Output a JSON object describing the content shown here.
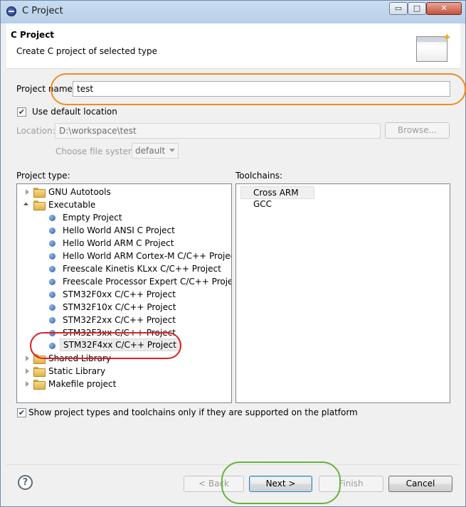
{
  "window": {
    "title": "C Project",
    "min_label": "▭",
    "max_label": "□",
    "close_label": "✕"
  },
  "header": {
    "title": "C Project",
    "description": "Create C project of selected type",
    "banner_icon": "wizard-banner-icon"
  },
  "form": {
    "project_name_label": "Project name:",
    "project_name_value": "test",
    "use_default_location_label": "Use default location",
    "use_default_location_checked": true,
    "location_label": "Location:",
    "location_value": "D:\\workspace\\test",
    "browse_label": "Browse...",
    "choose_fs_label": "Choose file system:",
    "file_system_value": "default"
  },
  "project_type": {
    "label": "Project type:",
    "items": [
      {
        "label": "GNU Autotools"
      },
      {
        "label": "Executable"
      },
      {
        "label": "Empty Project"
      },
      {
        "label": "Hello World ANSI C Project"
      },
      {
        "label": "Hello World ARM C Project"
      },
      {
        "label": "Hello World ARM Cortex-M C/C++ Project"
      },
      {
        "label": "Freescale Kinetis KLxx C/C++ Project"
      },
      {
        "label": "Freescale Processor Expert C/C++ Project"
      },
      {
        "label": "STM32F0xx C/C++ Project"
      },
      {
        "label": "STM32F10x C/C++ Project"
      },
      {
        "label": "STM32F2xx C/C++ Project"
      },
      {
        "label": "STM32F3xx C/C++ Project"
      },
      {
        "label": "STM32F4xx C/C++ Project"
      },
      {
        "label": "Shared Library"
      },
      {
        "label": "Static Library"
      },
      {
        "label": "Makefile project"
      }
    ],
    "selected": "STM32F4xx C/C++ Project"
  },
  "toolchains": {
    "label": "Toolchains:",
    "items": [
      "Cross ARM GCC"
    ]
  },
  "show_supported": {
    "label": "Show project types and toolchains only if they are supported on the platform",
    "checked": true
  },
  "footer": {
    "help_label": "?",
    "back_label": "< Back",
    "next_label": "Next >",
    "finish_label": "Finish",
    "cancel_label": "Cancel"
  },
  "colors": {
    "highlight_project_name": "#f08c1e",
    "highlight_selected_type": "#df1f26",
    "highlight_next": "#64b43c"
  }
}
